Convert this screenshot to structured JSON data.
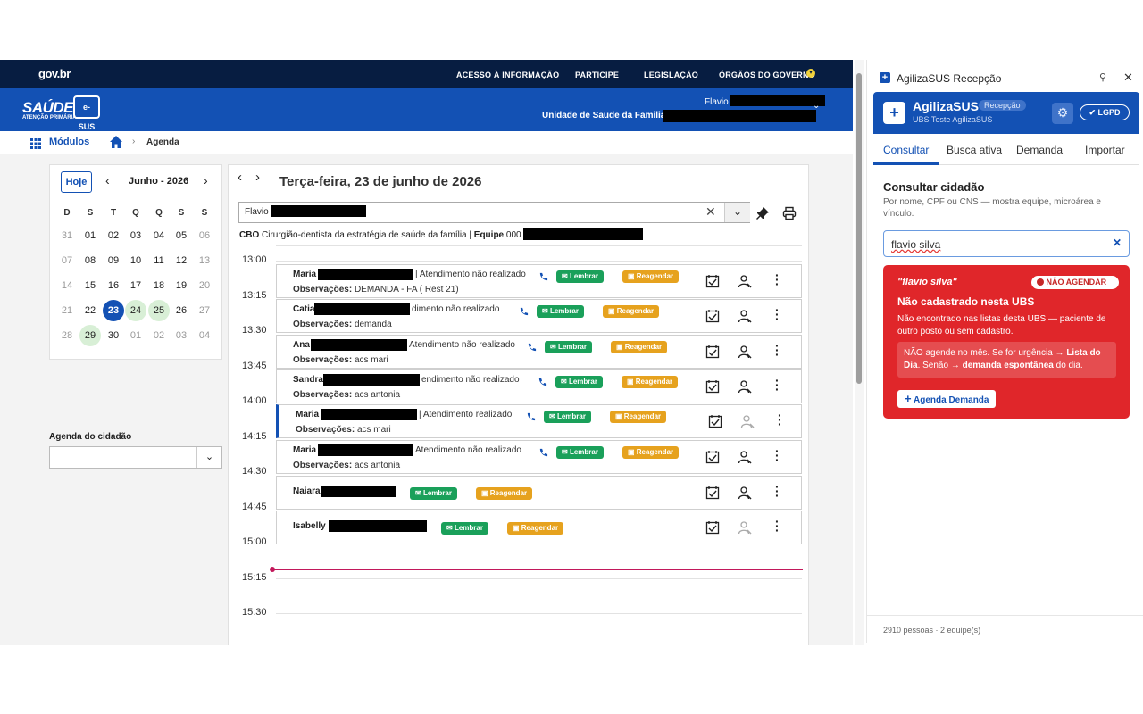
{
  "gov": {
    "logo": "gov.br",
    "links": [
      "ACESSO À INFORMAÇÃO",
      "PARTICIPE",
      "LEGISLAÇÃO",
      "ÓRGÃOS DO GOVERNO"
    ]
  },
  "header": {
    "brand": "SAÚDE",
    "brand_sub": "ATENÇÃO PRIMÁRIA",
    "esus": "e-SUS",
    "user_name": "Flavio",
    "unit_label": "Unidade de Saude da Familia"
  },
  "breadcrumb": {
    "modules": "Módulos",
    "page": "Agenda"
  },
  "calendar": {
    "today_button": "Hoje",
    "month": "Junho - 2026",
    "weekdays": [
      "D",
      "S",
      "T",
      "Q",
      "Q",
      "S",
      "S"
    ],
    "days": [
      "31",
      "01",
      "02",
      "03",
      "04",
      "05",
      "06",
      "07",
      "08",
      "09",
      "10",
      "11",
      "12",
      "13",
      "14",
      "15",
      "16",
      "17",
      "18",
      "19",
      "20",
      "21",
      "22",
      "23",
      "24",
      "25",
      "26",
      "27",
      "28",
      "29",
      "30",
      "01",
      "02",
      "03",
      "04"
    ]
  },
  "citizen_agenda": {
    "label": "Agenda do cidadão"
  },
  "schedule": {
    "date_title": "Terça-feira, 23 de junho de 2026",
    "professional": "Flavio",
    "cbo_label": "CBO",
    "cbo_value": "Cirurgião-dentista da estratégia de saúde da família",
    "team_label": "Equipe",
    "team_value": "000",
    "times": [
      "13:00",
      "13:15",
      "13:30",
      "13:45",
      "14:00",
      "14:15",
      "14:30",
      "14:45",
      "15:00",
      "15:15",
      "15:30"
    ],
    "remind_label": "Lembrar",
    "reschedule_label": "Reagendar",
    "obs_label": "Observações:",
    "appointments": [
      {
        "name": "Maria",
        "status": "| Atendimento não realizado",
        "obs": "DEMANDA - FA ( Rest 21)"
      },
      {
        "name": "Catia",
        "status": "dimento não realizado",
        "obs": "demanda"
      },
      {
        "name": "Ana",
        "status": "Atendimento não realizado",
        "obs": "acs mari"
      },
      {
        "name": "Sandra",
        "status": "endimento não realizado",
        "obs": "acs antonia"
      },
      {
        "name": "Maria",
        "status": "| Atendimento realizado",
        "obs": "acs mari"
      },
      {
        "name": "Maria",
        "status": "Atendimento não realizado",
        "obs": "acs antonia"
      },
      {
        "name": "Naiara",
        "status": "",
        "obs": ""
      },
      {
        "name": "Isabelly",
        "status": "",
        "obs": ""
      }
    ]
  },
  "panel": {
    "title": "AgilizaSUS Recepção",
    "brand": "AgilizaSUS",
    "brand_tag": "Recepção",
    "ubs": "UBS Teste AgilizaSUS",
    "lgpd": "LGPD",
    "tabs": [
      "Consultar",
      "Busca ativa",
      "Demanda",
      "Importar"
    ],
    "section_title": "Consultar cidadão",
    "section_hint": "Por nome, CPF ou CNS — mostra equipe, microárea e vínculo.",
    "search_value": "flavio silva",
    "alert": {
      "query": "\"flavio silva\"",
      "badge": "NÃO AGENDAR",
      "title": "Não cadastrado nesta UBS",
      "text": "Não encontrado nas listas desta UBS — paciente de outro posto ou sem cadastro.",
      "warn_a": "NÃO agende no mês. Se for urgência → ",
      "warn_b": "Lista do Dia",
      "warn_c": ". Senão → ",
      "warn_d": "demanda espontânea",
      "warn_e": " do dia.",
      "button": "Agenda Demanda"
    },
    "footer": "2910 pessoas · 2 equipe(s)"
  },
  "colors": {
    "gov_dark": "#071d41",
    "gov_blue": "#1351b4",
    "alert_red": "#e0262a",
    "green": "#1aa05a",
    "orange": "#e6a21e"
  }
}
